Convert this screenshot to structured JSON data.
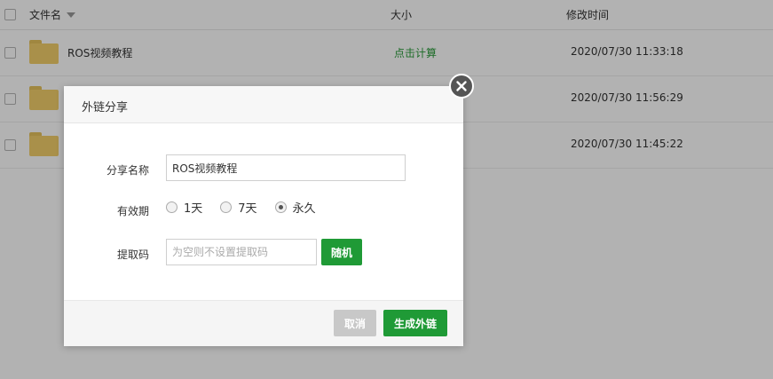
{
  "header": {
    "col_name": "文件名",
    "col_size": "大小",
    "col_time": "修改时间"
  },
  "rows": [
    {
      "name": "ROS视频教程",
      "size": "点击计算",
      "time": "2020/07/30 11:33:18"
    },
    {
      "name": "",
      "size": "",
      "time": "2020/07/30 11:56:29"
    },
    {
      "name": "",
      "size": "",
      "time": "2020/07/30 11:45:22"
    }
  ],
  "dialog": {
    "title": "外链分享",
    "share_name_label": "分享名称",
    "share_name_value": "ROS视频教程",
    "validity_label": "有效期",
    "validity_options": [
      "1天",
      "7天",
      "永久"
    ],
    "validity_selected": "永久",
    "code_label": "提取码",
    "code_placeholder": "为空则不设置提取码",
    "random_btn": "随机",
    "cancel_btn": "取消",
    "generate_btn": "生成外链"
  },
  "colors": {
    "accent": "#1f9a36",
    "link": "#2a9b3a",
    "folder": "#f2cf6b"
  }
}
